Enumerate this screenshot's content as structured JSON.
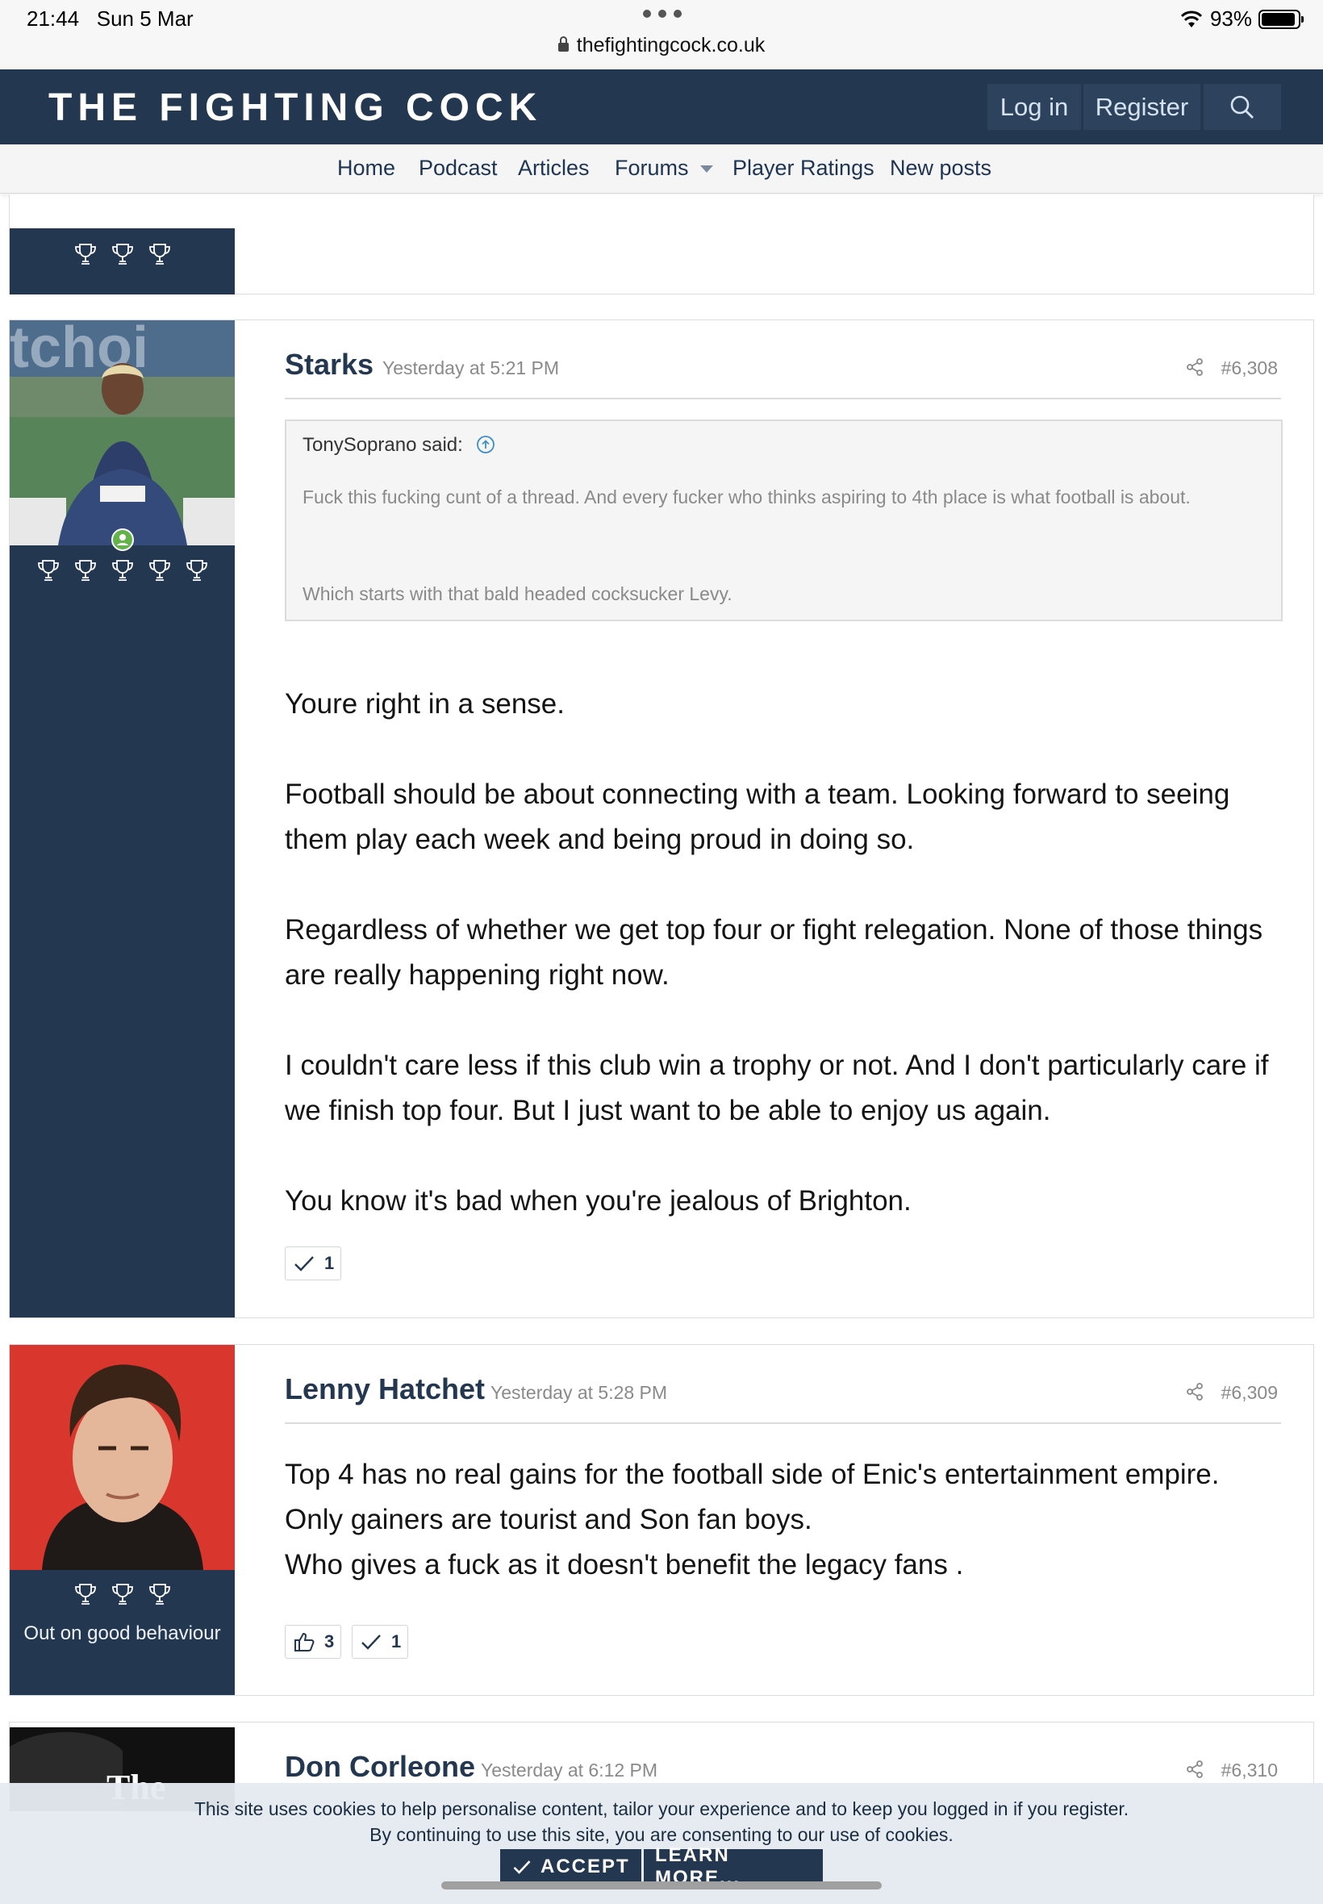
{
  "status_bar": {
    "time": "21:44",
    "date": "Sun 5 Mar",
    "url": "thefightingcock.co.uk",
    "battery": "93%",
    "battery_level": 0.93
  },
  "header": {
    "logo": "THE FIGHTING COCK",
    "login": "Log in",
    "register": "Register"
  },
  "nav": {
    "home": "Home",
    "podcast": "Podcast",
    "articles": "Articles",
    "forums": "Forums",
    "player_ratings": "Player Ratings",
    "new_posts": "New posts"
  },
  "posts": [
    {
      "username": "Starks",
      "time": "Yesterday at 5:21 PM",
      "number": "#6,308",
      "trophies": 5,
      "quote": {
        "author": "TonySoprano said:",
        "lines": [
          "Fuck this fucking cunt of a thread. And every fucker who thinks aspiring to 4th place is what football is about.",
          "Which starts with that bald headed cocksucker Levy."
        ]
      },
      "paragraphs": [
        "Youre right in a sense.",
        "Football should be about connecting with a team. Looking forward to seeing them play each week and being proud in doing so.",
        "Regardless of whether we get top four or fight relegation. None of those things are really happening right now.",
        "I couldn't care less if this club win a trophy or not. And I don't particularly care if we finish top four. But I just want to be able to enjoy us again.",
        "You know it's bad when you're jealous of Brighton."
      ],
      "reactions": {
        "agree": "1"
      }
    },
    {
      "username": "Lenny Hatchet",
      "time": "Yesterday at 5:28 PM",
      "number": "#6,309",
      "trophies": 3,
      "user_title": "Out on good behaviour",
      "paragraphs": [
        "Top 4 has no real gains for the football side of Enic's entertainment empire.\nOnly gainers are tourist and Son fan boys.\nWho gives a fuck as it doesn't benefit the legacy fans ."
      ],
      "reactions": {
        "like": "3",
        "agree": "1"
      }
    },
    {
      "username": "Don Corleone",
      "time": "Yesterday at 6:12 PM",
      "number": "#6,310"
    }
  ],
  "previous_post": {
    "trophies": 3
  },
  "cookie": {
    "line1": "This site uses cookies to help personalise content, tailor your experience and to keep you logged in if you register.",
    "line2": "By continuing to use this site, you are consenting to our use of cookies.",
    "accept": "ACCEPT",
    "learn_more": "LEARN MORE..."
  },
  "icons": [
    "search-icon",
    "trophy-icon",
    "share-icon",
    "quote-jump-icon",
    "checkmark-icon",
    "thumbs-up-icon",
    "online-status-icon",
    "lock-icon",
    "wifi-icon",
    "battery-icon"
  ],
  "colors": {
    "header": "#233850",
    "nav_text": "#1d3552",
    "user_pane": "#233850",
    "page_bg": "#ffffff",
    "quote_bg": "#f5f5f5"
  }
}
